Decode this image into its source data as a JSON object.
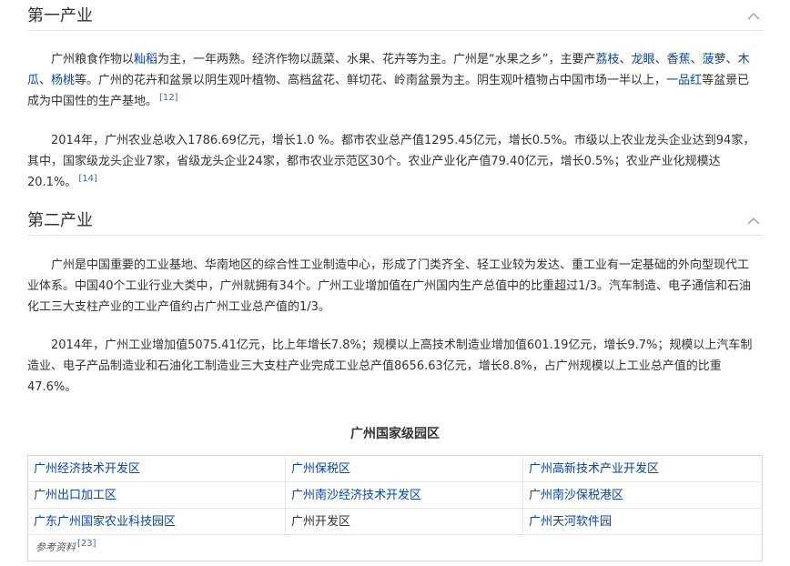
{
  "section1": {
    "title": "第一产业",
    "p1": {
      "t0": "广州粮食作物以",
      "l0": "籼稻",
      "t1": "为主，一年两熟。经济作物以蔬菜、水果、花卉等为主。广州是“水果之乡”，主要产",
      "l1": "荔枝",
      "t2": "、",
      "l2": "龙眼",
      "t3": "、",
      "l3": "香蕉",
      "t4": "、",
      "l4": "菠萝",
      "t5": "、",
      "l5": "木瓜",
      "t6": "、",
      "l6": "杨桃",
      "t7": "等。广州的花卉和盆景以阴生观叶植物、高档盆花、鲜切花、岭南盆景为主。阴生观叶植物占中国市场一半以上，",
      "l7": "一品红",
      "t8": "等盆景已成为中国性的生产基地。",
      "ref": "[12]"
    },
    "p2": {
      "text": "2014年，广州农业总收入1786.69亿元，增长1.0 %。都市农业总产值1295.45亿元，增长0.5%。市级以上农业龙头企业达到94家，其中，国家级龙头企业7家，省级龙头企业24家，都市农业示范区30个。农业产业化产值79.40亿元，增长0.5%；农业产业化规模达20.1%。",
      "ref": "[14]"
    }
  },
  "section2": {
    "title": "第二产业",
    "p1": "广州是中国重要的工业基地、华南地区的综合性工业制造中心，形成了门类齐全、轻工业较为发达、重工业有一定基础的外向型现代工业体系。中国40个工业行业大类中，广州就拥有34个。广州工业增加值在广州国内生产总值中的比重超过1/3。汽车制造、电子通信和石油化工三大支柱产业的工业产值约占广州工业总产值的1/3。",
    "p2": "2014年，广州工业增加值5075.41亿元，比上年增长7.8%；规模以上高技术制造业增加值601.19亿元，增长9.7%；规模以上汽车制造业、电子产品制造业和石油化工制造业三大支柱产业完成工业总产值8656.63亿元，增长8.8%，占广州规模以上工业总产值的比重47.6%。"
  },
  "parks": {
    "title": "广州国家级园区",
    "rows": [
      [
        "广州经济技术开发区",
        "广州保税区",
        "广州高新技术产业开发区"
      ],
      [
        "广州出口加工区",
        "广州南沙经济技术开发区",
        "广州南沙保税港区"
      ],
      [
        "广东广州国家农业科技园区",
        "广州开发区",
        "广州天河软件园"
      ]
    ],
    "refs_label": "参考资料",
    "refs_num": "[23]"
  },
  "colors": {
    "link": "#0645ad",
    "text": "#333333",
    "border": "#d8d8d8"
  },
  "icons": {
    "collapse": "chevron-up-icon"
  }
}
